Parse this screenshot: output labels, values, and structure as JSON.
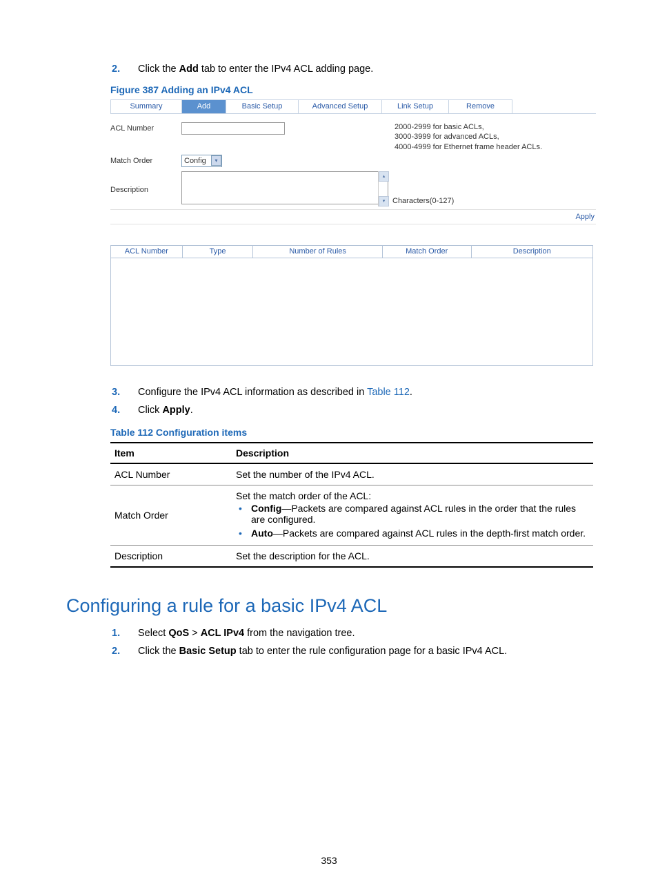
{
  "steps_top": {
    "s2_num": "2.",
    "s2_pre": "Click the ",
    "s2_bold": "Add",
    "s2_post": " tab to enter the IPv4 ACL adding page."
  },
  "figure": {
    "caption": "Figure 387 Adding an IPv4 ACL",
    "tabs": {
      "summary": "Summary",
      "add": "Add",
      "basic": "Basic Setup",
      "advanced": "Advanced Setup",
      "link": "Link Setup",
      "remove": "Remove"
    },
    "labels": {
      "acl_number": "ACL Number",
      "match_order": "Match Order",
      "description": "Description"
    },
    "select_value": "Config",
    "help1": "2000-2999 for basic ACLs,",
    "help2": "3000-3999 for advanced ACLs,",
    "help3": "4000-4999 for Ethernet frame header ACLs.",
    "chars": "Characters(0-127)",
    "apply": "Apply"
  },
  "list_table": {
    "h1": "ACL Number",
    "h2": "Type",
    "h3": "Number of Rules",
    "h4": "Match Order",
    "h5": "Description"
  },
  "steps_mid": {
    "s3_num": "3.",
    "s3_pre": "Configure the IPv4 ACL information as described in ",
    "s3_link": "Table 112",
    "s3_post": ".",
    "s4_num": "4.",
    "s4_pre": "Click ",
    "s4_bold": "Apply",
    "s4_post": "."
  },
  "table112": {
    "caption": "Table 112 Configuration items",
    "head_item": "Item",
    "head_desc": "Description",
    "r1_item": "ACL Number",
    "r1_desc": "Set the number of the IPv4 ACL.",
    "r2_item": "Match Order",
    "r2_intro": "Set the match order of the ACL:",
    "r2_b1_bold": "Config",
    "r2_b1_rest": "—Packets are compared against ACL rules in the order that the rules are configured.",
    "r2_b2_bold": "Auto",
    "r2_b2_rest": "—Packets are compared against ACL rules in the depth-first match order.",
    "r3_item": "Description",
    "r3_desc": "Set the description for the ACL."
  },
  "h2": "Configuring a rule for a basic IPv4 ACL",
  "steps_bottom": {
    "s1_num": "1.",
    "s1_pre": "Select ",
    "s1_b1": "QoS",
    "s1_gt": " > ",
    "s1_b2": "ACL IPv4",
    "s1_post": " from the navigation tree.",
    "s2_num": "2.",
    "s2_pre": "Click the ",
    "s2_bold": "Basic Setup",
    "s2_post": " tab to enter the rule configuration page for a basic IPv4 ACL."
  },
  "page_number": "353"
}
